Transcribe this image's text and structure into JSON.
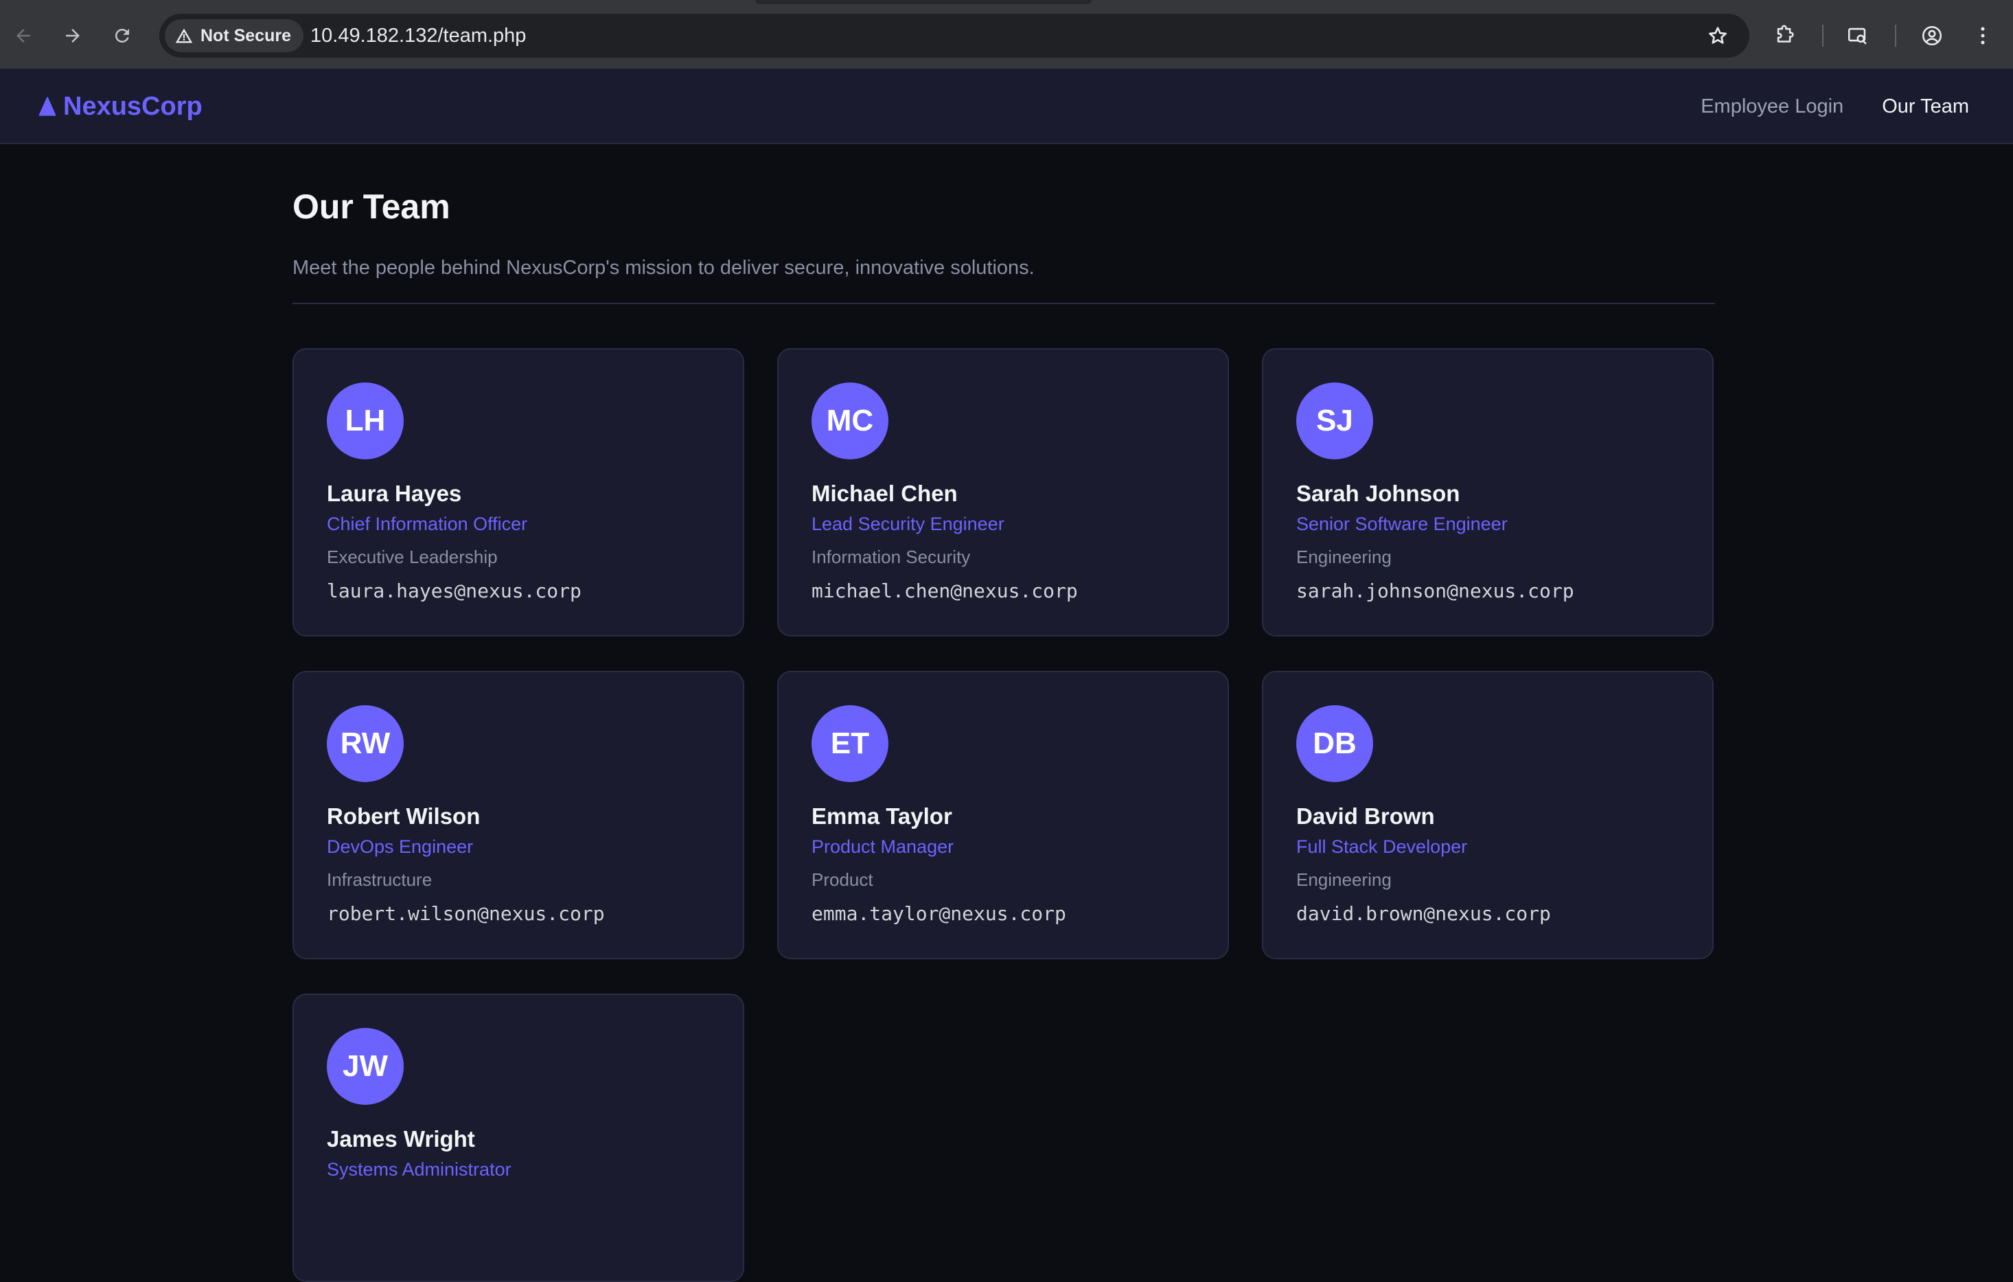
{
  "browser": {
    "security_label": "Not Secure",
    "url": "10.49.182.132/team.php"
  },
  "site": {
    "brand": "NexusCorp",
    "brand_icon": "triangle-logo-icon",
    "nav": [
      "Employee Login",
      "Our Team"
    ],
    "active_nav": "Our Team"
  },
  "page": {
    "title": "Our Team",
    "intro": "Meet the people behind NexusCorp's mission to deliver secure, innovative solutions."
  },
  "team": [
    {
      "initials": "LH",
      "name": "Laura Hayes",
      "role": "Chief Information Officer",
      "department": "Executive Leadership",
      "email": "laura.hayes@nexus.corp"
    },
    {
      "initials": "MC",
      "name": "Michael Chen",
      "role": "Lead Security Engineer",
      "department": "Information Security",
      "email": "michael.chen@nexus.corp"
    },
    {
      "initials": "SJ",
      "name": "Sarah Johnson",
      "role": "Senior Software Engineer",
      "department": "Engineering",
      "email": "sarah.johnson@nexus.corp"
    },
    {
      "initials": "RW",
      "name": "Robert Wilson",
      "role": "DevOps Engineer",
      "department": "Infrastructure",
      "email": "robert.wilson@nexus.corp"
    },
    {
      "initials": "ET",
      "name": "Emma Taylor",
      "role": "Product Manager",
      "department": "Product",
      "email": "emma.taylor@nexus.corp"
    },
    {
      "initials": "DB",
      "name": "David Brown",
      "role": "Full Stack Developer",
      "department": "Engineering",
      "email": "david.brown@nexus.corp"
    },
    {
      "initials": "JW",
      "name": "James Wright",
      "role": "Systems Administrator",
      "department": "",
      "email": ""
    }
  ],
  "colors": {
    "accent": "#6c63ff",
    "header_bg": "#1a1b2e",
    "page_bg": "#0b0d13",
    "card_bg": "#1a1b2e",
    "card_border": "#2a2c42"
  }
}
